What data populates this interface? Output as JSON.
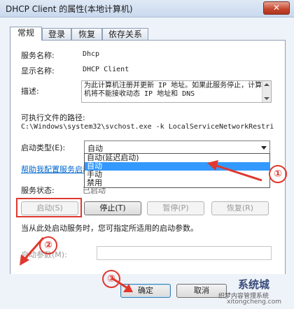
{
  "window": {
    "title": "DHCP Client 的属性(本地计算机)",
    "close_glyph": "✕"
  },
  "tabs": [
    {
      "label": "常规",
      "active": true
    },
    {
      "label": "登录",
      "active": false
    },
    {
      "label": "恢复",
      "active": false
    },
    {
      "label": "依存关系",
      "active": false
    }
  ],
  "general": {
    "service_name_label": "服务名称:",
    "service_name_value": "Dhcp",
    "display_name_label": "显示名称:",
    "display_name_value": "DHCP Client",
    "description_label": "描述:",
    "description_value": "为此计算机注册并更新 IP 地址。如果此服务停止，计算机将不能接收动态 IP 地址和 DNS",
    "exe_path_label": "可执行文件的路径:",
    "exe_path_value": "C:\\Windows\\system32\\svchost.exe -k LocalServiceNetworkRestri",
    "startup_type_label": "启动类型(E):",
    "startup_type_value": "自动",
    "startup_options": [
      "自动(延迟启动)",
      "自动",
      "手动",
      "禁用"
    ],
    "startup_selected_index": 1,
    "help_link": "帮助我配置服务启动",
    "status_label": "服务状态:",
    "status_value": "已启动",
    "start_button": "启动(S)",
    "stop_button": "停止(T)",
    "pause_button": "暂停(P)",
    "resume_button": "恢复(R)",
    "hint_text": "当从此处启动服务时，您可指定所适用的启动参数。",
    "params_label": "启动参数(M):"
  },
  "footer": {
    "ok_button": "确定",
    "cancel_button": "取消"
  },
  "annotations": {
    "callout_1": "①",
    "callout_2": "②",
    "callout_3": "③",
    "color": "#e0372e"
  },
  "watermark": {
    "title": "系统城",
    "subtitle": "织梦内容管理系统",
    "url": "xitongcheng.com"
  }
}
